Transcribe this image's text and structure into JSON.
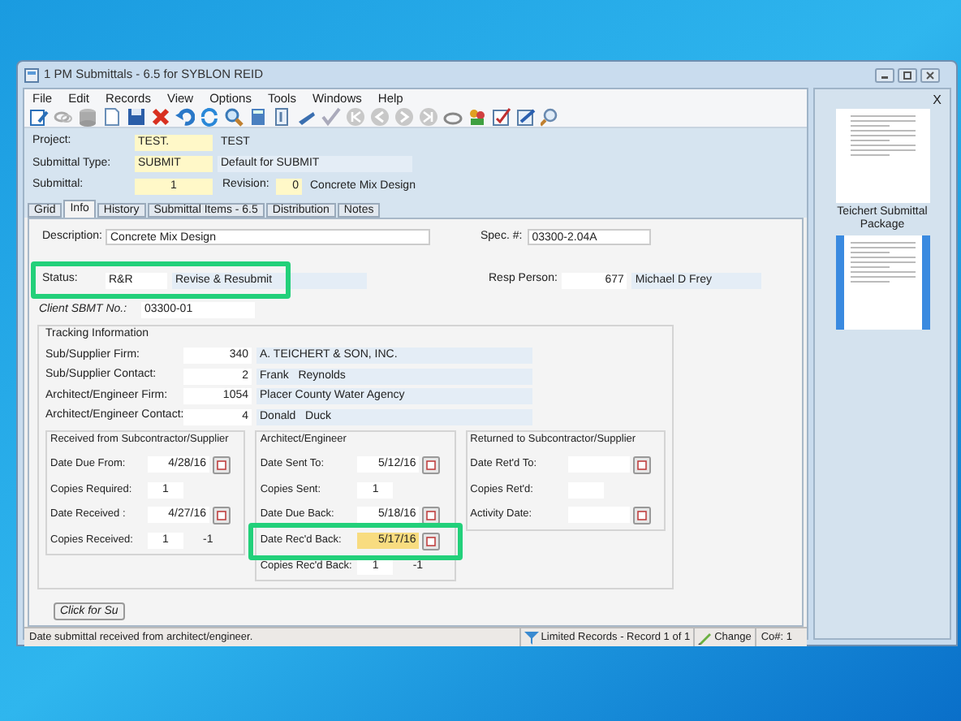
{
  "window": {
    "title": "1 PM Submittals - 6.5 for SYBLON REID"
  },
  "menu": [
    "File",
    "Edit",
    "Records",
    "View",
    "Options",
    "Tools",
    "Windows",
    "Help"
  ],
  "header": {
    "project_label": "Project:",
    "project_code": "TEST.",
    "project_name": "TEST",
    "type_label": "Submittal Type:",
    "type_code": "SUBMIT",
    "type_desc": "Default for SUBMIT",
    "submittal_label": "Submittal:",
    "submittal_number": "1",
    "revision_label": "Revision:",
    "revision": "0",
    "submittal_desc": "Concrete Mix Design"
  },
  "tabs": [
    {
      "label": "Grid",
      "selected": false
    },
    {
      "label": "Info",
      "selected": true
    },
    {
      "label": "History",
      "selected": false
    },
    {
      "label": "Submittal Items - 6.5",
      "selected": false
    },
    {
      "label": "Distribution",
      "selected": false
    },
    {
      "label": "Notes",
      "selected": false
    }
  ],
  "info": {
    "description_label": "Description:",
    "description": "Concrete Mix Design",
    "spec_label": "Spec. #:",
    "spec": "03300-2.04A",
    "status_label": "Status:",
    "status_code": "R&R",
    "status_desc": "Revise & Resubmit",
    "resp_label": "Resp Person:",
    "resp_number": "677",
    "resp_name": "Michael D Frey",
    "client_label": "Client SBMT No.:",
    "client_value": "03300-01"
  },
  "tracking": {
    "title": "Tracking Information",
    "rows": [
      {
        "label": "Sub/Supplier Firm:",
        "number": "340",
        "name": "A. TEICHERT & SON, INC."
      },
      {
        "label": "Sub/Supplier Contact:",
        "number": "2",
        "name": "Frank   Reynolds"
      },
      {
        "label": "Architect/Engineer Firm:",
        "number": "1054",
        "name": "Placer County Water Agency"
      },
      {
        "label": "Architect/Engineer Contact:",
        "number": "4",
        "name": "Donald   Duck"
      }
    ],
    "groups": [
      {
        "title": "Received from Subcontractor/Supplier",
        "rows": [
          {
            "kind": "date",
            "label": "Date Due From:",
            "value": "4/28/16",
            "focused": false
          },
          {
            "kind": "count",
            "label": "Copies Required:",
            "value": "1",
            "focused": false
          },
          {
            "kind": "date",
            "label": "Date Received :",
            "value": "4/27/16",
            "focused": false
          },
          {
            "kind": "count",
            "label": "Copies Received:",
            "value": "1",
            "extra": "-1",
            "focused": false
          }
        ]
      },
      {
        "title": "Architect/Engineer",
        "rows": [
          {
            "kind": "date",
            "label": "Date Sent To:",
            "value": "5/12/16",
            "focused": false
          },
          {
            "kind": "count",
            "label": "Copies Sent:",
            "value": "1",
            "focused": false
          },
          {
            "kind": "date",
            "label": "Date Due Back:",
            "value": "5/18/16",
            "focused": false
          },
          {
            "kind": "date",
            "label": "Date Rec'd Back:",
            "value": "5/17/16",
            "focused": true
          },
          {
            "kind": "count",
            "label": "Copies Rec'd Back:",
            "value": "1",
            "extra": "-1",
            "focused": false
          }
        ]
      },
      {
        "title": "Returned to Subcontractor/Supplier",
        "rows": [
          {
            "kind": "date",
            "label": "Date Ret'd To:",
            "value": "",
            "focused": false
          },
          {
            "kind": "count",
            "label": "Copies Ret'd:",
            "value": "",
            "focused": false
          },
          {
            "kind": "date",
            "label": "Activity Date:",
            "value": "",
            "focused": false
          }
        ]
      }
    ]
  },
  "summary_button": "Click for Su",
  "status_bar": {
    "message": "Date submittal received from architect/engineer.",
    "records": "Limited Records - Record 1 of 1",
    "mode": "Change",
    "company": "Co#: 1"
  },
  "side_panel": {
    "close": "X",
    "documents": [
      {
        "caption": "Teichert Submittal Package",
        "selected": false
      },
      {
        "selected": true
      }
    ]
  }
}
